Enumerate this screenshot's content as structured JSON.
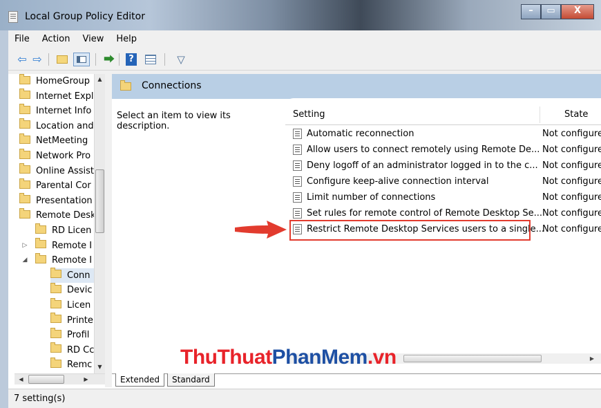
{
  "window": {
    "title": "Local Group Policy Editor",
    "controls": [
      "–",
      "▭",
      "X"
    ]
  },
  "menu": [
    "File",
    "Action",
    "View",
    "Help"
  ],
  "toolbar": {
    "back": "back-icon",
    "forward": "forward-icon",
    "help": "?"
  },
  "tree": [
    {
      "label": "HomeGroup",
      "indent": 0
    },
    {
      "label": "Internet Expl",
      "indent": 0
    },
    {
      "label": "Internet Info",
      "indent": 0
    },
    {
      "label": "Location and",
      "indent": 0
    },
    {
      "label": "NetMeeting",
      "indent": 0
    },
    {
      "label": "Network Pro",
      "indent": 0
    },
    {
      "label": "Online Assist",
      "indent": 0
    },
    {
      "label": "Parental Cor",
      "indent": 0
    },
    {
      "label": "Presentation",
      "indent": 0
    },
    {
      "label": "Remote Desk",
      "indent": 0
    },
    {
      "label": "RD Licen",
      "indent": 1
    },
    {
      "label": "Remote I",
      "indent": 1,
      "expander": "collapsed"
    },
    {
      "label": "Remote I",
      "indent": 1,
      "expander": "expanded"
    },
    {
      "label": "Conn",
      "indent": 2,
      "selected": true
    },
    {
      "label": "Devic",
      "indent": 2
    },
    {
      "label": "Licen",
      "indent": 2
    },
    {
      "label": "Printe",
      "indent": 2
    },
    {
      "label": "Profil",
      "indent": 2
    },
    {
      "label": "RD Cc",
      "indent": 2
    },
    {
      "label": "Remc",
      "indent": 2
    }
  ],
  "right": {
    "header_title": "Connections",
    "description": "Select an item to view its description.",
    "columns": {
      "setting": "Setting",
      "state": "State"
    },
    "rows": [
      {
        "setting": "Automatic reconnection",
        "state": "Not configure"
      },
      {
        "setting": "Allow users to connect remotely using Remote De...",
        "state": "Not configure"
      },
      {
        "setting": "Deny logoff of an administrator logged in to the c...",
        "state": "Not configure"
      },
      {
        "setting": "Configure keep-alive connection interval",
        "state": "Not configure"
      },
      {
        "setting": "Limit number of connections",
        "state": "Not configure"
      },
      {
        "setting": "Set rules for remote control of Remote Desktop Se...",
        "state": "Not configure"
      },
      {
        "setting": "Restrict Remote Desktop Services users to a single...",
        "state": "Not configure",
        "highlighted": true
      }
    ]
  },
  "tabs": [
    "Extended",
    "Standard"
  ],
  "status": "7 setting(s)",
  "watermark": {
    "part1": "ThuThuat",
    "part2": "PhanMem",
    "part3": ".vn"
  },
  "colors": {
    "highlight": "#e23b2e",
    "header_bg": "#b9cfe5"
  }
}
